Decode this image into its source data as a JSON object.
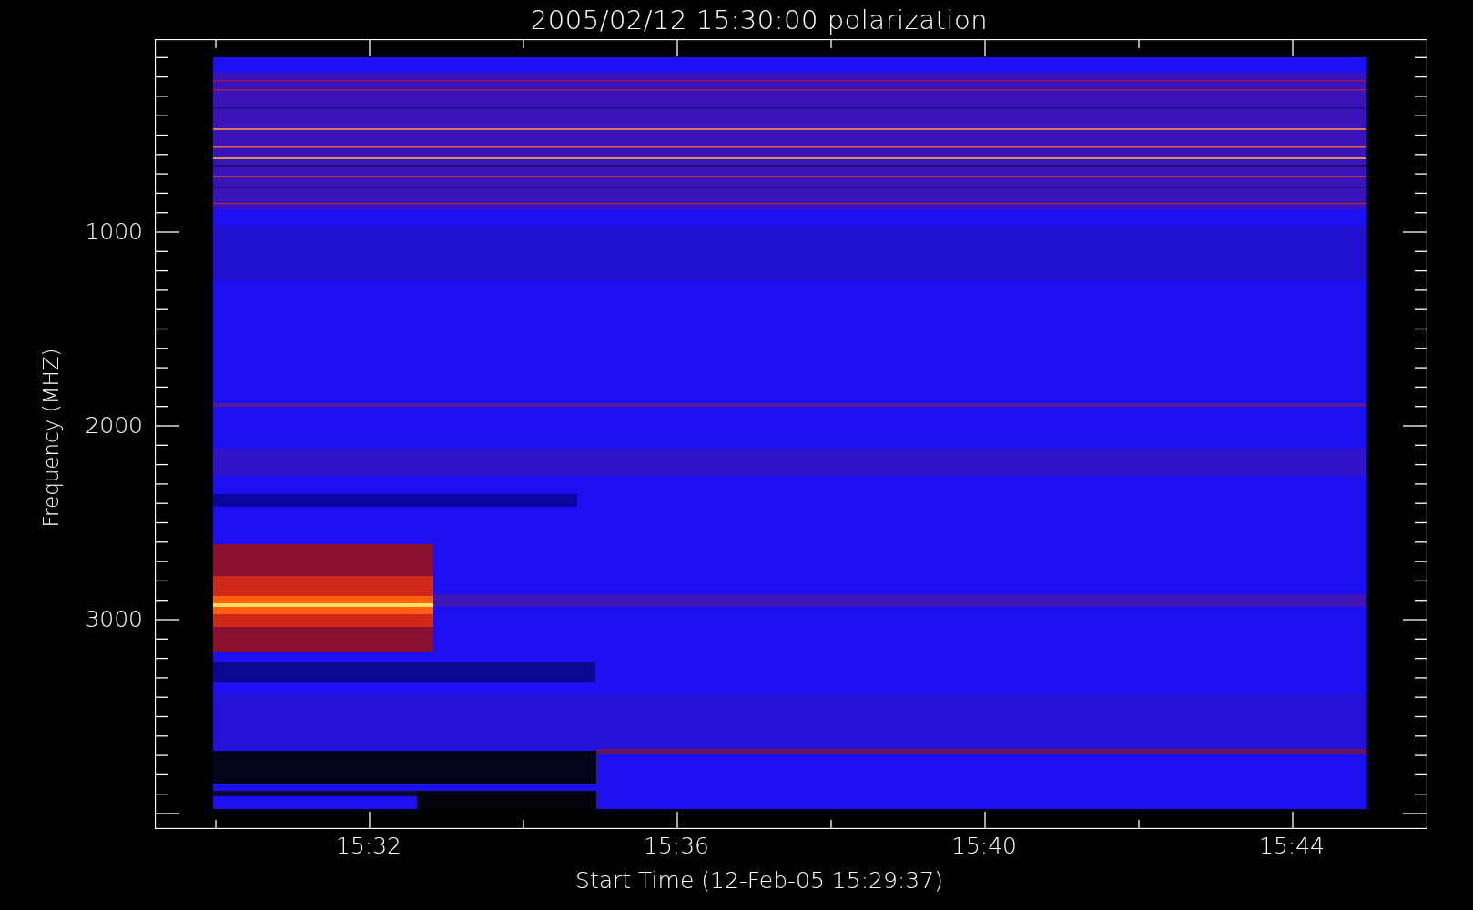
{
  "title": "2005/02/12 15:30:00 polarization",
  "y_axis": {
    "label": "Frequency (MHZ)",
    "ticks": [
      "1000",
      "2000",
      "3000"
    ]
  },
  "x_axis": {
    "label": "Start Time (12-Feb-05 15:29:37)",
    "ticks": [
      "15:32",
      "15:36",
      "15:40",
      "15:44"
    ]
  }
}
